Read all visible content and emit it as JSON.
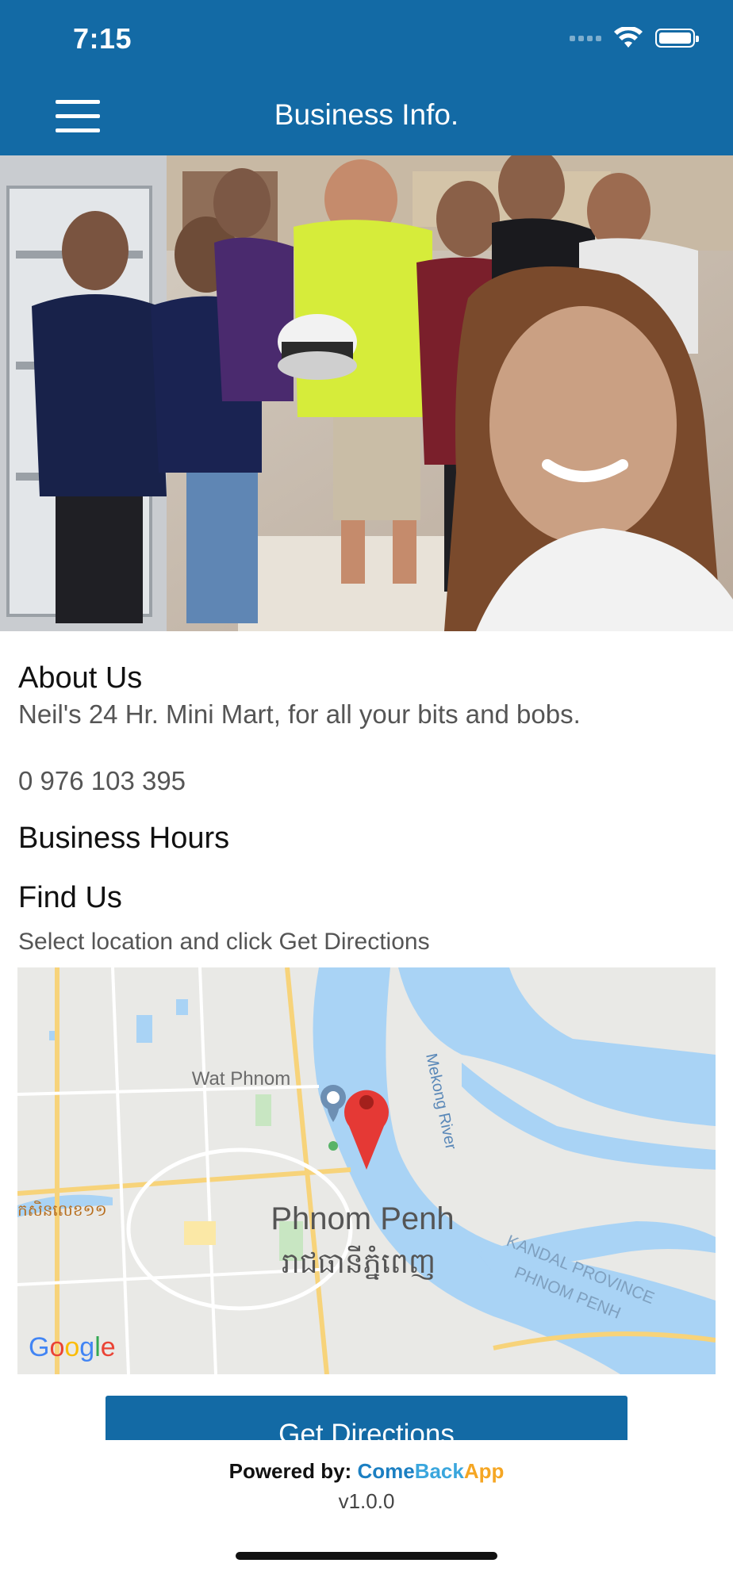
{
  "status_bar": {
    "time": "7:15"
  },
  "header": {
    "title": "Business Info.",
    "menu_icon": "hamburger-menu-icon"
  },
  "photo": {
    "description_icon": "business-photo"
  },
  "about": {
    "heading": "About Us",
    "text": "Neil's 24 Hr. Mini Mart, for all your bits and bobs.",
    "phone": "0 976 103 395"
  },
  "hours": {
    "heading": "Business Hours"
  },
  "find": {
    "heading": "Find Us",
    "instruction": "Select location and click Get Directions"
  },
  "map": {
    "labels": {
      "wat_phnom": "Wat Phnom",
      "mekong": "Mekong River",
      "city": "Phnom Penh",
      "city_khmer": "រាជធានីភ្នំពេញ",
      "street_khmer": "កសិនលេខ១១",
      "province": "KANDAL PROVINCE",
      "phnom_penh_caps": "PHNOM PENH"
    },
    "google": [
      "G",
      "o",
      "o",
      "g",
      "l",
      "e"
    ],
    "google_colors": [
      "#4285F4",
      "#EA4335",
      "#FBBC05",
      "#4285F4",
      "#34A853",
      "#EA4335"
    ],
    "water_color": "#a9d3f5",
    "land_color": "#e9e9e6",
    "pin_color": "#e53935"
  },
  "button": {
    "label": "Get Directions"
  },
  "footer": {
    "powered_by": "Powered by:",
    "brand_come": "Come",
    "brand_back": "Back",
    "brand_app": "App",
    "version": "v1.0.0"
  },
  "colors": {
    "primary": "#136aa5"
  }
}
